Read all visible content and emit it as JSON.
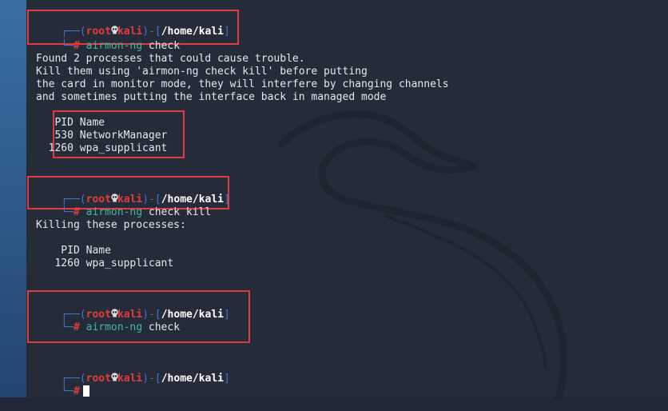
{
  "prompt": {
    "top_left": "┌──(",
    "user": "root",
    "skull": "💀",
    "host": "kali",
    "mid": ")-[",
    "path": "/home/kali",
    "end": "]",
    "bottom": "└─",
    "hash": "#"
  },
  "block1": {
    "cmd_tool": "airmon-ng",
    "cmd_args": "check",
    "out1": "Found 2 processes that could cause trouble.",
    "out2": "Kill them using 'airmon-ng check kill' before putting",
    "out3": "the card in monitor mode, they will interfere by changing channels",
    "out4": "and sometimes putting the interface back in managed mode",
    "table_header": "   PID Name",
    "row1": "   530 NetworkManager",
    "row2": "  1260 wpa_supplicant"
  },
  "block2": {
    "cmd_tool": "airmon-ng",
    "cmd_args": "check kill",
    "out1": "Killing these processes:",
    "table_header": "    PID Name",
    "row1": "   1260 wpa_supplicant"
  },
  "block3": {
    "cmd_tool": "airmon-ng",
    "cmd_args": "check"
  },
  "colors": {
    "border_red": "#e03b3b",
    "prompt_blue": "#3f74c8",
    "user_red": "#e23c3c",
    "cmd_green": "#41b8a2",
    "background": "#262b3a"
  }
}
